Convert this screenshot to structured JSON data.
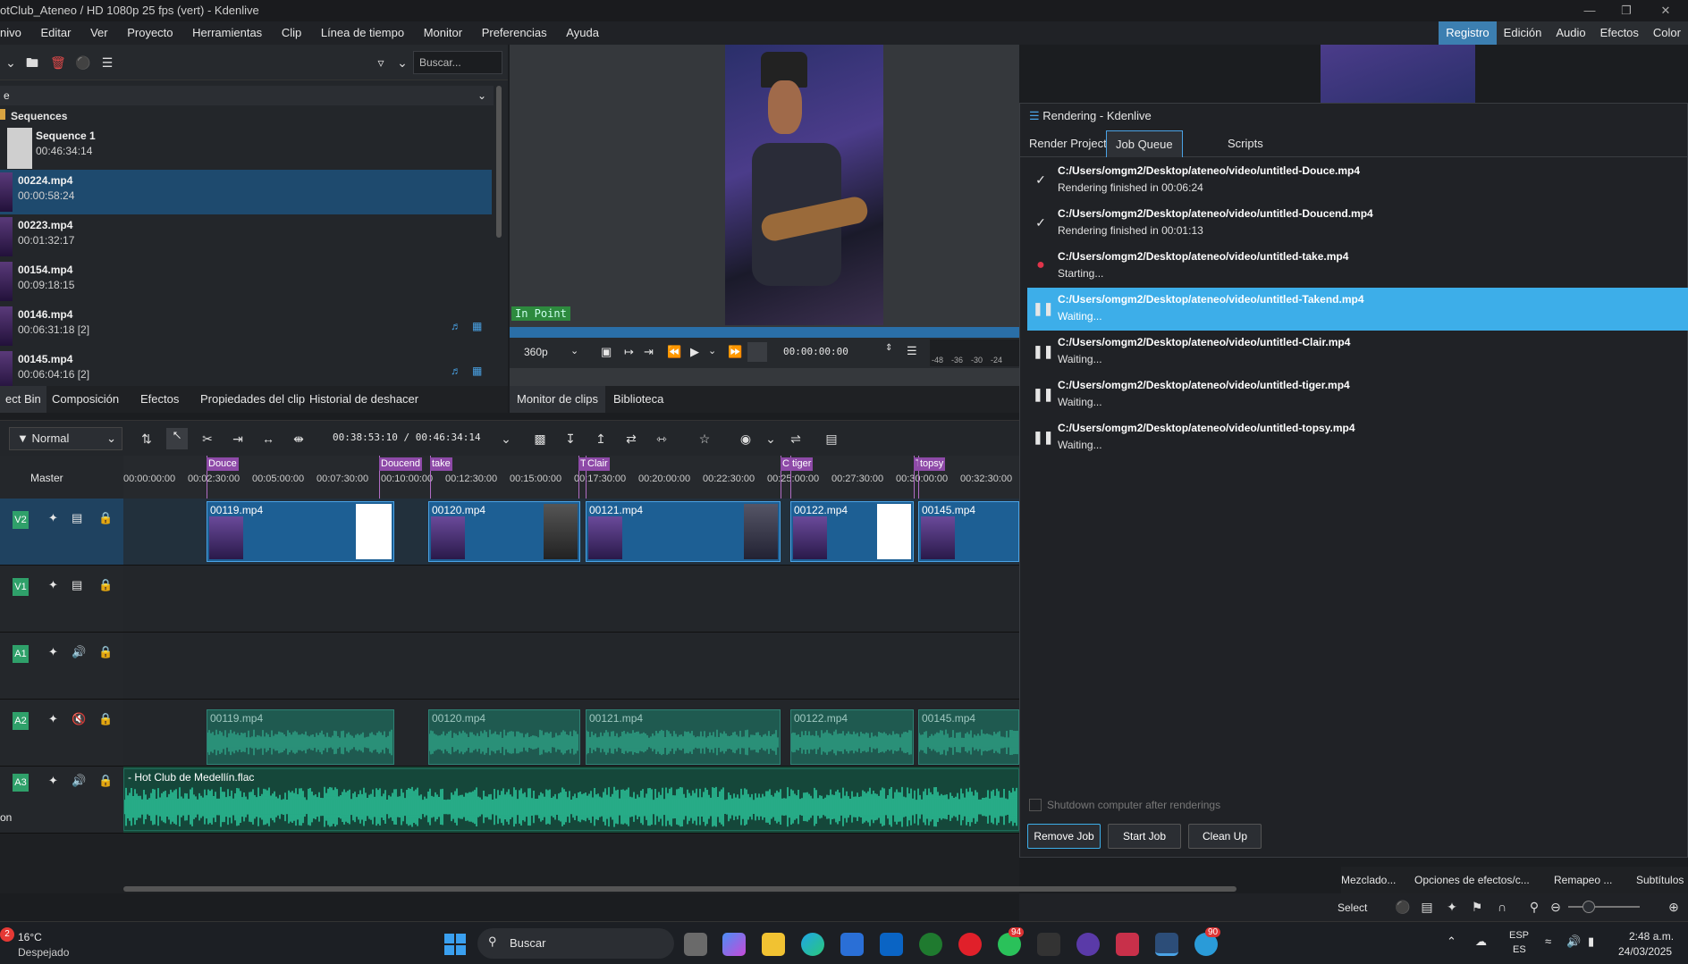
{
  "window": {
    "title": "otClub_Ateneo / HD 1080p 25 fps (vert) - Kdenlive"
  },
  "menu": [
    "nivo",
    "Editar",
    "Ver",
    "Proyecto",
    "Herramientas",
    "Clip",
    "Línea de tiempo",
    "Monitor",
    "Preferencias",
    "Ayuda"
  ],
  "workspaces": [
    "Registro",
    "Edición",
    "Audio",
    "Efectos",
    "Color"
  ],
  "bin": {
    "search_placeholder": "Buscar...",
    "header": "e",
    "folder": "Sequences",
    "items": [
      {
        "name": "Sequence 1",
        "duration": "00:46:34:14"
      },
      {
        "name": "00224.mp4",
        "duration": "00:00:58:24"
      },
      {
        "name": "00223.mp4",
        "duration": "00:01:32:17"
      },
      {
        "name": "00154.mp4",
        "duration": "00:09:18:15"
      },
      {
        "name": "00146.mp4",
        "duration": "00:06:31:18 [2]"
      },
      {
        "name": "00145.mp4",
        "duration": "00:06:04:16 [2]"
      }
    ],
    "tabs": [
      "ect Bin",
      "Composición",
      "Efectos",
      "Propiedades del clip",
      "Historial de deshacer"
    ]
  },
  "monitor": {
    "in_point": "In Point",
    "zoom": "360p",
    "timecode": "00:00:00:00",
    "meter": [
      "-48",
      "-36",
      "-30",
      "-24"
    ],
    "tabs": [
      "Monitor de clips",
      "Biblioteca"
    ]
  },
  "timeline_tools": {
    "mode": "Normal",
    "timecode": "00:38:53:10 / 00:46:34:14"
  },
  "timeline": {
    "master": "Master",
    "ruler": [
      "00:00:00:00",
      "00:02:30:00",
      "00:05:00:00",
      "00:07:30:00",
      "00:10:00:00",
      "00:12:30:00",
      "00:15:00:00",
      "00:17:30:00",
      "00:20:00:00",
      "00:22:30:00",
      "00:25:00:00",
      "00:27:30:00",
      "00:30:00:00",
      "00:32:30:00"
    ],
    "guides": [
      "Douce",
      "Doucend",
      "take",
      "T",
      "Clair",
      "C",
      "tiger",
      "T",
      "topsy"
    ],
    "tracks": [
      "V2",
      "V1",
      "A1",
      "A2",
      "A3"
    ],
    "video_clips": [
      "00119.mp4",
      "00120.mp4",
      "00121.mp4",
      "00122.mp4",
      "00145.mp4"
    ],
    "audio_clips": [
      "00119.mp4",
      "00120.mp4",
      "00121.mp4",
      "00122.mp4",
      "00145.mp4"
    ],
    "music": "- Hot Club de Medellín.flac",
    "a3_extra": "on"
  },
  "render": {
    "title": "Rendering - Kdenlive",
    "tabs": [
      "Render Project",
      "Job Queue",
      "Scripts"
    ],
    "jobs": [
      {
        "path": "C:/Users/omgm2/Desktop/ateneo/video/untitled-Douce.mp4",
        "status": "Rendering finished in 00:06:24"
      },
      {
        "path": "C:/Users/omgm2/Desktop/ateneo/video/untitled-Doucend.mp4",
        "status": "Rendering finished in 00:01:13"
      },
      {
        "path": "C:/Users/omgm2/Desktop/ateneo/video/untitled-take.mp4",
        "status": "Starting..."
      },
      {
        "path": "C:/Users/omgm2/Desktop/ateneo/video/untitled-Takend.mp4",
        "status": "Waiting..."
      },
      {
        "path": "C:/Users/omgm2/Desktop/ateneo/video/untitled-Clair.mp4",
        "status": "Waiting..."
      },
      {
        "path": "C:/Users/omgm2/Desktop/ateneo/video/untitled-tiger.mp4",
        "status": "Waiting..."
      },
      {
        "path": "C:/Users/omgm2/Desktop/ateneo/video/untitled-topsy.mp4",
        "status": "Waiting..."
      }
    ],
    "shutdown": "Shutdown computer after renderings",
    "buttons": [
      "Remove Job",
      "Start Job",
      "Clean Up"
    ]
  },
  "status": {
    "tabs": [
      "Mezclado...",
      "Opciones de efectos/c...",
      "Remapeo ...",
      "Subtítulos"
    ],
    "select": "Select"
  },
  "taskbar": {
    "weather_temp": "16°C",
    "weather_desc": "Despejado",
    "search": "Buscar",
    "lang1": "ESP",
    "lang2": "ES",
    "time": "2:48 a.m.",
    "date": "24/03/2025",
    "badge1": "94",
    "badge2": "90",
    "weather_badge": "2"
  }
}
